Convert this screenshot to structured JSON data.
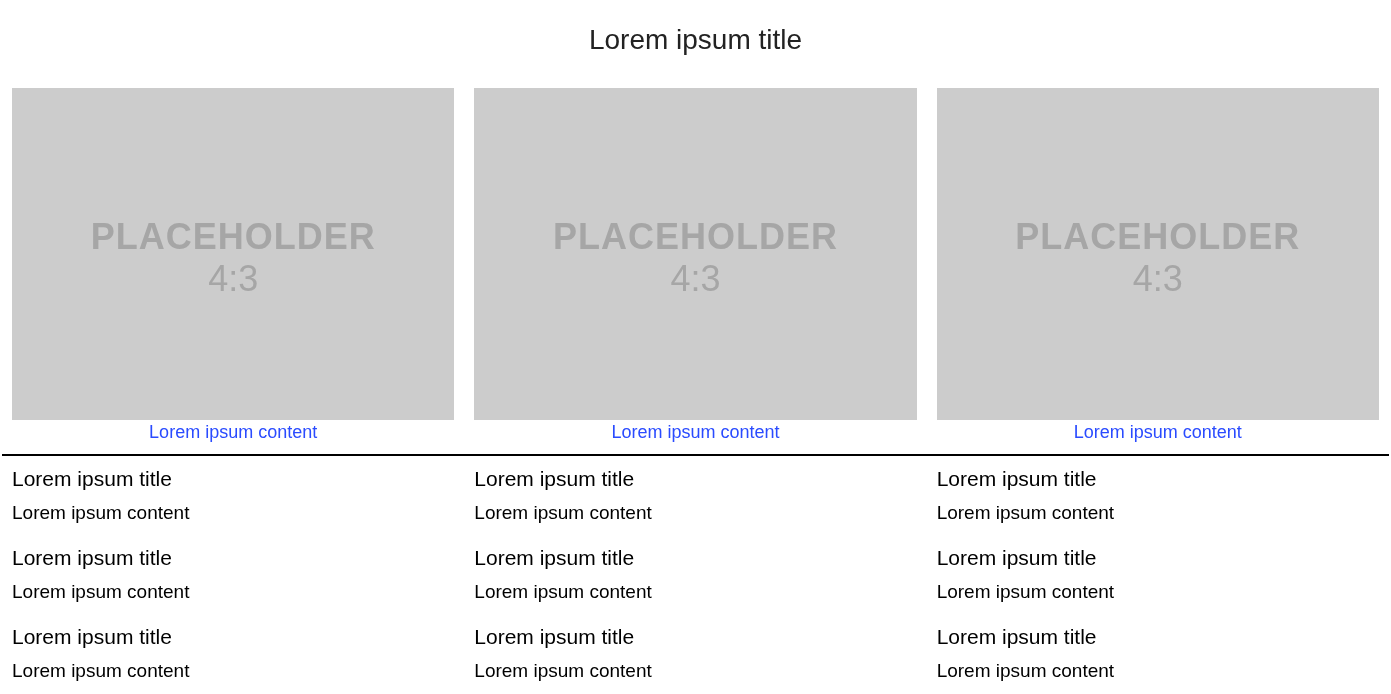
{
  "title": "Lorem ipsum title",
  "cards": [
    {
      "image_label": [
        "PLACEHOLDER",
        "4:3"
      ],
      "link": "Lorem ipsum content"
    },
    {
      "image_label": [
        "PLACEHOLDER",
        "4:3"
      ],
      "link": "Lorem ipsum content"
    },
    {
      "image_label": [
        "PLACEHOLDER",
        "4:3"
      ],
      "link": "Lorem ipsum content"
    }
  ],
  "columns": [
    [
      {
        "title": "Lorem ipsum title",
        "content": "Lorem ipsum content"
      },
      {
        "title": "Lorem ipsum title",
        "content": "Lorem ipsum content"
      },
      {
        "title": "Lorem ipsum title",
        "content": "Lorem ipsum content"
      }
    ],
    [
      {
        "title": "Lorem ipsum title",
        "content": "Lorem ipsum content"
      },
      {
        "title": "Lorem ipsum title",
        "content": "Lorem ipsum content"
      },
      {
        "title": "Lorem ipsum title",
        "content": "Lorem ipsum content"
      }
    ],
    [
      {
        "title": "Lorem ipsum title",
        "content": "Lorem ipsum content"
      },
      {
        "title": "Lorem ipsum title",
        "content": "Lorem ipsum content"
      },
      {
        "title": "Lorem ipsum title",
        "content": "Lorem ipsum content"
      }
    ]
  ]
}
